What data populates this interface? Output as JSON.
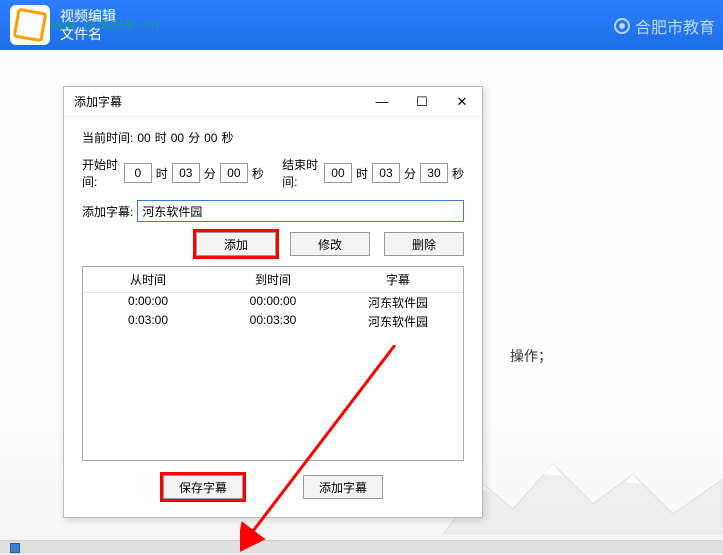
{
  "topbar": {
    "line1": "视频编辑",
    "line2": "文件名",
    "brand_right": "合肥市教育",
    "watermark": "www.pc0359.cn"
  },
  "dialog": {
    "title": "添加字幕",
    "current_time_label": "当前时间:",
    "cur_h": "00",
    "cur_h_unit": "时",
    "cur_m": "00",
    "cur_m_unit": "分",
    "cur_s": "00",
    "cur_s_unit": "秒",
    "start_label": "开始时间:",
    "start_h": "0",
    "start_m": "03",
    "start_s": "00",
    "end_label": "结束时间:",
    "end_h": "00",
    "end_m": "03",
    "end_s": "30",
    "unit_h": "时",
    "unit_m": "分",
    "unit_s": "秒",
    "subtitle_label": "添加字幕:",
    "subtitle_value": "河东软件园",
    "btn_add": "添加",
    "btn_modify": "修改",
    "btn_delete": "删除",
    "col_from": "从时间",
    "col_to": "到时间",
    "col_sub": "字幕",
    "rows": [
      {
        "from": "0:00:00",
        "to": "00:00:00",
        "sub": "河东软件园"
      },
      {
        "from": "0:03:00",
        "to": "00:03:30",
        "sub": "河东软件园"
      }
    ],
    "btn_save": "保存字幕",
    "btn_add_sub": "添加字幕"
  },
  "side_text": "操作；"
}
